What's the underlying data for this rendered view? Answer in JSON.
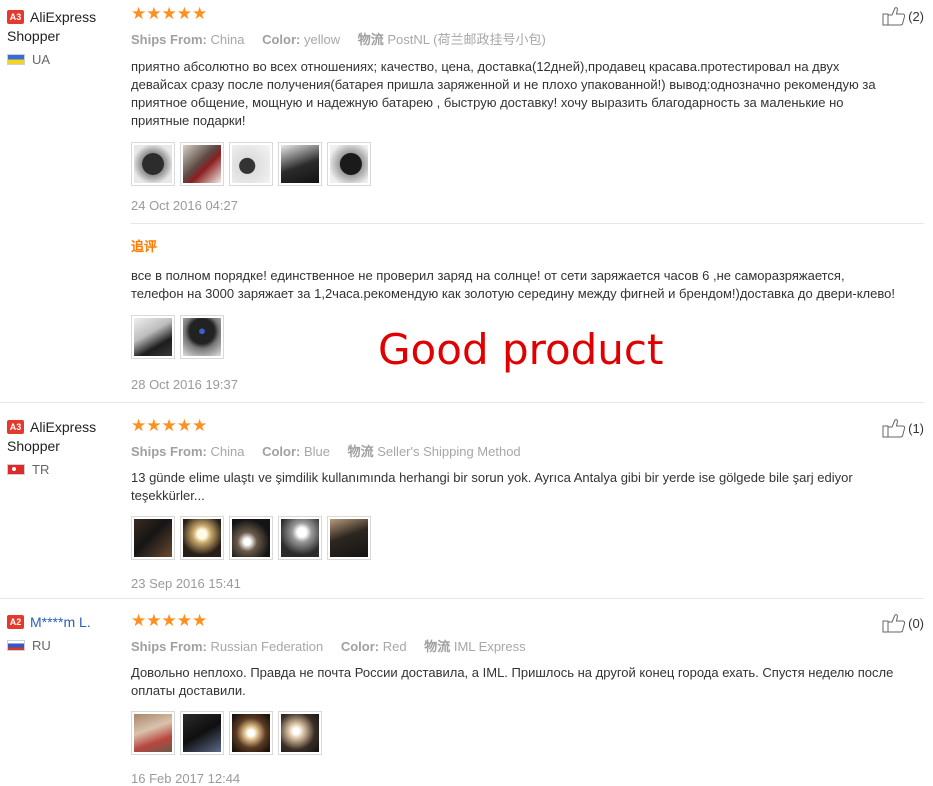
{
  "reviews": [
    {
      "badge": "A3",
      "name": "AliExpress Shopper",
      "country": "UA",
      "stars": "★★★★★",
      "ships_from_label": "Ships From:",
      "ships_from": "China",
      "color_label": "Color:",
      "color": "yellow",
      "logistics_label": "物流",
      "logistics": "PostNL (荷兰邮政挂号小包)",
      "text": "приятно абсолютно во всех отношениях; качество, цена, доставка(12дней),продавец красава.протестировал на двух девайсах сразу после получения(батарея пришла заряженной и не плохо упакованной!) вывод:однозначно рекомендую за приятное общение, мощную и надежную батарею , быструю доставку! хочу выразить благодарность за маленькие но приятные подарки!",
      "date": "24 Oct 2016 04:27",
      "helpful_count": "(2)",
      "followup": {
        "label": "追评",
        "text": "все в полном порядке! единственное не проверил заряд на солнце! от сети заряжается часов 6 ,не саморазряжается, телефон на 3000 заряжает за 1,2часа.рекомендую как золотую середину между фигней и брендом!)доставка до двери-клево!",
        "date": "28 Oct 2016 19:37"
      }
    },
    {
      "badge": "A3",
      "name": "AliExpress Shopper",
      "country": "TR",
      "stars": "★★★★★",
      "ships_from_label": "Ships From:",
      "ships_from": "China",
      "color_label": "Color:",
      "color": "Blue",
      "logistics_label": "物流",
      "logistics": "Seller's Shipping Method",
      "text": "13 günde elime ulaştı ve şimdilik kullanımında herhangi bir sorun yok. Ayrıca Antalya gibi bir yerde ise gölgede bile şarj ediyor teşekkürler...",
      "date": "23 Sep 2016 15:41",
      "helpful_count": "(1)"
    },
    {
      "badge": "A2",
      "name": "M****m L.",
      "country": "RU",
      "stars": "★★★★★",
      "ships_from_label": "Ships From:",
      "ships_from": "Russian Federation",
      "color_label": "Color:",
      "color": "Red",
      "logistics_label": "物流",
      "logistics": "IML Express",
      "text": "Довольно неплохо. Правда не почта России доставила, а IML. Пришлось на другой конец города ехать. Спустя неделю после оплаты доставили.",
      "date": "16 Feb 2017 12:44",
      "helpful_count": "(0)"
    }
  ],
  "overlay": "Good product",
  "colors": {
    "star": "#ff8f1f",
    "badge": "#e4392c",
    "followup_label": "#ff7a00",
    "overlay": "#e00000",
    "link": "#2a5fbd"
  }
}
